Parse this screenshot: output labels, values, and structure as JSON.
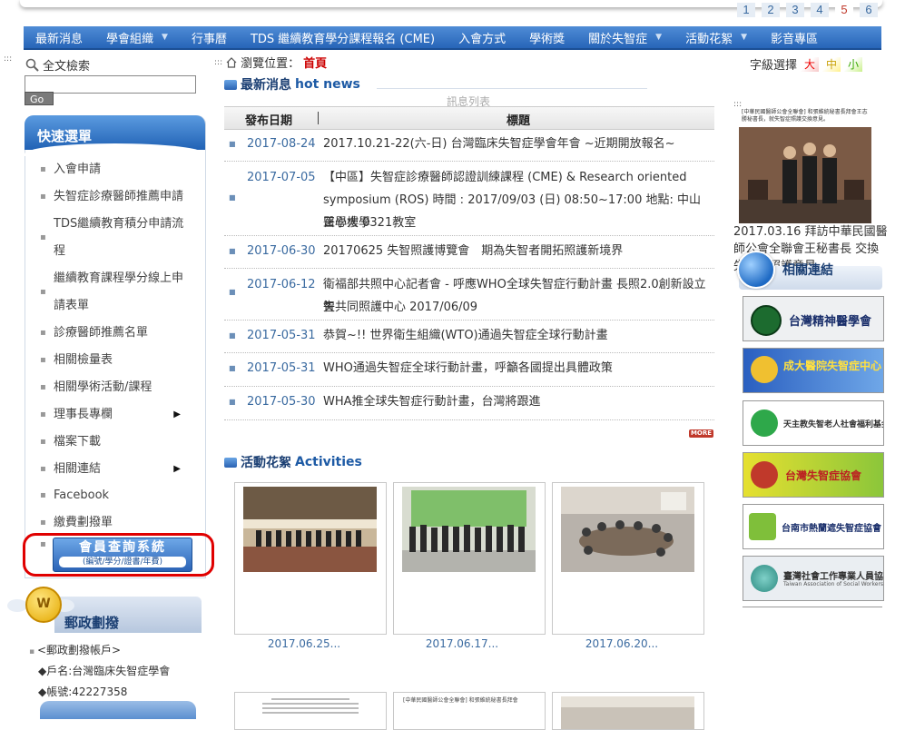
{
  "pager": [
    "1",
    "2",
    "3",
    "4",
    "5",
    "6"
  ],
  "pager_current": "5",
  "nav": [
    {
      "label": "最新消息",
      "dropdown": false
    },
    {
      "label": "學會組織",
      "dropdown": true
    },
    {
      "label": "行事曆",
      "dropdown": false
    },
    {
      "label": "TDS 繼續教育學分課程報名 (CME)",
      "dropdown": false
    },
    {
      "label": "入會方式",
      "dropdown": false
    },
    {
      "label": "學術獎",
      "dropdown": false
    },
    {
      "label": "關於失智症",
      "dropdown": true
    },
    {
      "label": "活動花絮",
      "dropdown": true
    },
    {
      "label": "影音專區",
      "dropdown": false
    }
  ],
  "search": {
    "label": "全文檢索",
    "button": "Go",
    "value": ""
  },
  "quick_menu": {
    "title": "快速選單",
    "items": [
      {
        "label": "入會申請",
        "submenu": false
      },
      {
        "label": "失智症診療醫師推薦申請",
        "submenu": false
      },
      {
        "label": "TDS繼續教育積分申請流程",
        "submenu": false
      },
      {
        "label": "繼續教育課程學分線上申請表單",
        "submenu": false
      },
      {
        "label": "診療醫師推薦名單",
        "submenu": false
      },
      {
        "label": "相關檢量表",
        "submenu": false
      },
      {
        "label": "相關學術活動/課程",
        "submenu": false
      },
      {
        "label": "理事長專欄",
        "submenu": true
      },
      {
        "label": "檔案下載",
        "submenu": false
      },
      {
        "label": "相關連結",
        "submenu": true
      },
      {
        "label": "Facebook",
        "submenu": false
      },
      {
        "label": "繳費劃撥單",
        "submenu": false
      }
    ],
    "member_button": {
      "main": "會員查詢系統",
      "sub": "(編號/學分/證書/年費)"
    }
  },
  "postal": {
    "title": "郵政劃撥",
    "coin": "W",
    "account_label": "<郵政劃撥帳戶>",
    "account_name": "◆戶名:台灣臨床失智症學會",
    "account_no": "◆帳號:42227358"
  },
  "breadcrumb": {
    "label": "瀏覽位置：",
    "current": "首頁"
  },
  "news": {
    "title_zh": "最新消息",
    "title_en": "hot news",
    "subtitle": "訊息列表",
    "col_date": "發布日期",
    "col_title": "標題",
    "more": "MORE",
    "rows": [
      {
        "date": "2017-08-24",
        "lines": [
          "2017.10.21-22(六-日) 台灣臨床失智症學會年會 ~近期開放報名~"
        ]
      },
      {
        "date": "2017-07-05",
        "lines": [
          "【中區】失智症診療醫師認證訓練課程 (CME) & Research oriented",
          "symposium (ROS) 時間 : 2017/09/03 (日) 08:50~17:00 地點: 中山醫學大學",
          "正心樓 0321教室"
        ]
      },
      {
        "date": "2017-06-30",
        "lines": [
          "20170625 失智照護博覽會　期為失智者開拓照護新境界"
        ]
      },
      {
        "date": "2017-06-12",
        "lines": [
          "衛福部共照中心記者會 - 呼應WHO全球失智症行動計畫 長照2.0創新設立失",
          "智共同照護中心 2017/06/09"
        ]
      },
      {
        "date": "2017-05-31",
        "lines": [
          "恭賀~!! 世界衛生組織(WTO)通過失智症全球行動計畫"
        ]
      },
      {
        "date": "2017-05-31",
        "lines": [
          "WHO通過失智症全球行動計畫，呼籲各國提出具體政策"
        ]
      },
      {
        "date": "2017-05-30",
        "lines": [
          "WHA推全球失智症行動計畫，台灣將跟進"
        ]
      }
    ]
  },
  "activities": {
    "title_zh": "活動花絮",
    "title_en": "Activities",
    "items": [
      {
        "caption": "2017.06.25..."
      },
      {
        "caption": "2017.06.17..."
      },
      {
        "caption": "2017.06.20..."
      }
    ],
    "doc_headers": [
      "",
      "[中華民國醫師公會全聯會] 和張維統秘書長拜會"
    ]
  },
  "font_size": {
    "label": "字級選擇",
    "large": "大",
    "medium": "中",
    "small": "小"
  },
  "right_feature": {
    "caption": "2017.03.16 拜訪中華民國醫師公會全聯會王秘書長 交換失智症照護意見",
    "photo_header": "[中華民國醫師公會全聯會] 和張維統秘書長拜會王志勝秘書長，就失智症照護交換意見。"
  },
  "related_links": {
    "title": "相關連結",
    "banners": [
      {
        "text": "台灣精神醫學會",
        "sub": ""
      },
      {
        "text": "成大醫院",
        "sub": "失智症中心"
      },
      {
        "text": "天主教失智老人社會福利基金會",
        "sub": ""
      },
      {
        "text": "台灣失智症協會",
        "sub": ""
      },
      {
        "text": "台南市熱蘭遮失智症協會",
        "sub": ""
      },
      {
        "text": "臺灣社會工作專業人員協會",
        "sub": "Taiwan Association of Social Workers"
      }
    ]
  },
  "colors": {
    "nav": "#2f6fc3",
    "accent_red": "#c00000",
    "link": "#3a6aa0",
    "highlight_box": "#e00000"
  }
}
